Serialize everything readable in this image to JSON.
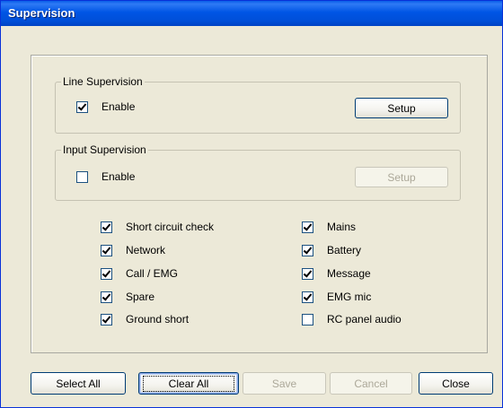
{
  "window": {
    "title": "Supervision"
  },
  "line_supervision": {
    "legend": "Line Supervision",
    "enable_label": "Enable",
    "enable_checked": true,
    "setup_label": "Setup",
    "setup_enabled": true
  },
  "input_supervision": {
    "legend": "Input Supervision",
    "enable_label": "Enable",
    "enable_checked": false,
    "setup_label": "Setup",
    "setup_enabled": false
  },
  "checks_left": [
    {
      "label": "Short circuit check",
      "checked": true
    },
    {
      "label": "Network",
      "checked": true
    },
    {
      "label": "Call / EMG",
      "checked": true
    },
    {
      "label": "Spare",
      "checked": true
    },
    {
      "label": "Ground short",
      "checked": true
    }
  ],
  "checks_right": [
    {
      "label": "Mains",
      "checked": true
    },
    {
      "label": "Battery",
      "checked": true
    },
    {
      "label": "Message",
      "checked": true
    },
    {
      "label": "EMG mic",
      "checked": true
    },
    {
      "label": "RC panel audio",
      "checked": false
    }
  ],
  "buttons": {
    "select_all": "Select All",
    "clear_all": "Clear All",
    "save": "Save",
    "cancel": "Cancel",
    "close": "Close"
  },
  "colors": {
    "title_bar": "#0055e5",
    "face": "#ece9d8",
    "disabled_text": "#aca899"
  }
}
